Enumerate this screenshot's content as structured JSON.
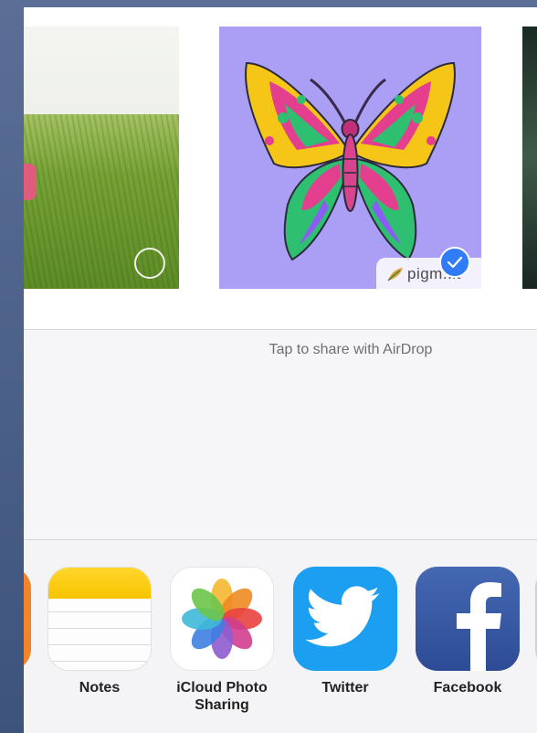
{
  "photos": {
    "watermark_text": "pigm..it",
    "selected_photo": "butterfly-coloring-image"
  },
  "airdrop": {
    "hint": "Tap to share with AirDrop"
  },
  "apps": [
    {
      "label": "Notes",
      "icon": "notes-app-icon"
    },
    {
      "label": "iCloud Photo Sharing",
      "icon": "photos-app-icon"
    },
    {
      "label": "Twitter",
      "icon": "twitter-app-icon"
    },
    {
      "label": "Facebook",
      "icon": "facebook-app-icon"
    }
  ],
  "colors": {
    "accent_check": "#2f7cf6",
    "twitter": "#1c9ff0",
    "facebook": "#3b5998",
    "notes_yellow": "#f8c400",
    "butterfly_background": "#ab9ff5"
  }
}
